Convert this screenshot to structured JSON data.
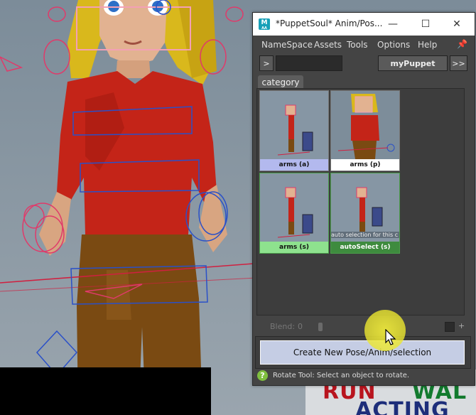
{
  "window": {
    "title": "*PuppetSoul* Anim/Pos...",
    "app_icon_label": "M",
    "app_icon_sub": "AA",
    "controls": {
      "minimize": "—",
      "maximize": "☐",
      "close": "✕"
    }
  },
  "menubar": {
    "items": [
      "NameSpace",
      "Assets",
      "Tools",
      "Options",
      "Help"
    ]
  },
  "toolbar": {
    "prev_label": ">",
    "namespace_value": "",
    "puppet_name": "myPuppet",
    "next_label": ">>"
  },
  "tabs": [
    {
      "label": "category"
    }
  ],
  "gallery": {
    "tiles": [
      {
        "label": "arms (a)",
        "color": "#b3b9ee",
        "text_color": "#111111"
      },
      {
        "label": "arms (p)",
        "color": "#ffffff",
        "text_color": "#111111"
      },
      {
        "label": "arms (s)",
        "color": "#8ee28e",
        "text_color": "#111111"
      },
      {
        "label": "autoSelect (s)",
        "color": "#3e8b3e",
        "text_color": "#ffffff",
        "overlay_text": "auto selection for this c"
      }
    ]
  },
  "blend": {
    "label": "Blend:",
    "value": "0",
    "plus_label": "+"
  },
  "create_button": {
    "label": "Create New Pose/Anim/selection"
  },
  "status": {
    "icon": "?",
    "text": "Rotate Tool: Select an object to rotate."
  },
  "background_sign": {
    "words": [
      "RUN",
      "WAL",
      "ACTING"
    ]
  }
}
